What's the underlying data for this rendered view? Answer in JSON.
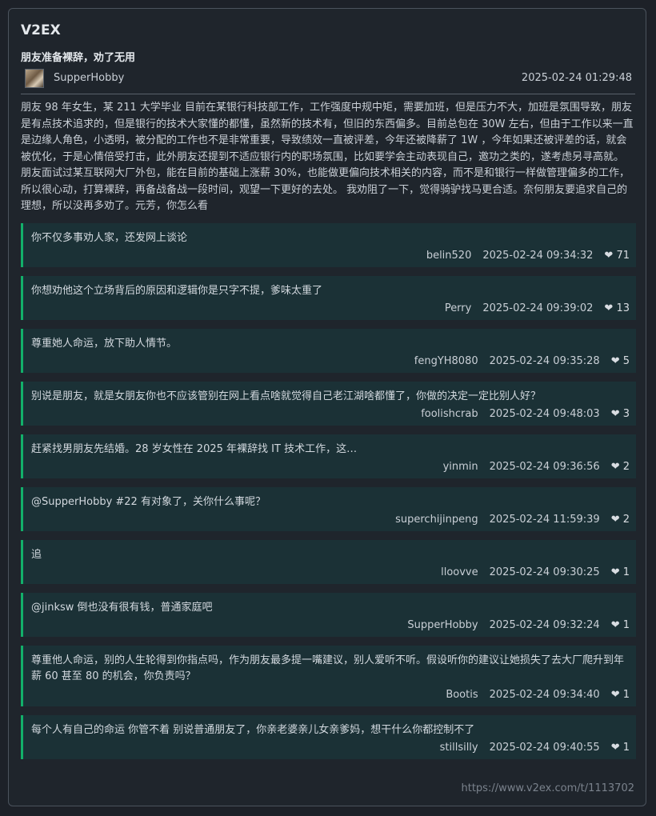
{
  "site": {
    "title": "V2EX"
  },
  "topic": {
    "title": "朋友准备裸辞，劝了无用",
    "author": "SupperHobby",
    "date": "2025-02-24 01:29:48",
    "content": "朋友 98 年女生，某 211 大学毕业 目前在某银行科技部工作，工作强度中规中矩，需要加班，但是压力不大，加班是氛围导致，朋友是有点技术追求的，但是银行的技术大家懂的都懂，虽然新的技术有，但旧的东西偏多。目前总包在 30W 左右，但由于工作以来一直是边缘人角色，小透明，被分配的工作也不是非常重要，导致绩效一直被评差，今年还被降薪了 1W ，今年如果还被评差的话，就会被优化，于是心情倍受打击，此外朋友还提到不适应银行内的职场氛围，比如要学会主动表现自己，邀功之类的，遂考虑另寻高就。 朋友面试过某互联网大厂外包，能在目前的基础上涨薪 30%，也能做更偏向技术相关的内容，而不是和银行一样做管理偏多的工作，所以很心动，打算裸辞，再备战备战一段时间，观望一下更好的去处。 我劝阻了一下，觉得骑驴找马更合适。奈何朋友要追求自己的理想，所以没再多劝了。元芳，你怎么看"
  },
  "replies": [
    {
      "text": "你不仅多事劝人家，还发网上谈论",
      "user": "belin520",
      "time": "2025-02-24 09:34:32",
      "likes": "❤ 71"
    },
    {
      "text": "你想劝他这个立场背后的原因和逻辑你是只字不提，爹味太重了",
      "user": "Perry",
      "time": "2025-02-24 09:39:02",
      "likes": "❤ 13"
    },
    {
      "text": "尊重她人命运，放下助人情节。",
      "user": "fengYH8080",
      "time": "2025-02-24 09:35:28",
      "likes": "❤ 5"
    },
    {
      "text": "别说是朋友，就是女朋友你也不应该管别在网上看点啥就觉得自己老江湖啥都懂了，你做的决定一定比别人好？",
      "user": "foolishcrab",
      "time": "2025-02-24 09:48:03",
      "likes": "❤ 3"
    },
    {
      "text": "赶紧找男朋友先结婚。28 岁女性在 2025 年裸辞找 IT 技术工作，这…",
      "user": "yinmin",
      "time": "2025-02-24 09:36:56",
      "likes": "❤ 2"
    },
    {
      "text": "@SupperHobby #22 有对象了，关你什么事呢？",
      "user": "superchijinpeng",
      "time": "2025-02-24 11:59:39",
      "likes": "❤ 2"
    },
    {
      "text": "追",
      "user": "lloovve",
      "time": "2025-02-24 09:30:25",
      "likes": "❤ 1"
    },
    {
      "text": "@jinksw 倒也没有很有钱，普通家庭吧",
      "user": "SupperHobby",
      "time": "2025-02-24 09:32:24",
      "likes": "❤ 1"
    },
    {
      "text": "尊重他人命运，别的人生轮得到你指点吗，作为朋友最多提一嘴建议，别人爱听不听。假设听你的建议让她损失了去大厂爬升到年薪 60 甚至 80 的机会，你负责吗？",
      "user": "Bootis",
      "time": "2025-02-24 09:34:40",
      "likes": "❤ 1"
    },
    {
      "text": "每个人有自己的命运 你管不着 别说普通朋友了，你亲老婆亲儿女亲爹妈，想干什么你都控制不了",
      "user": "stillsilly",
      "time": "2025-02-24 09:40:55",
      "likes": "❤ 1"
    }
  ],
  "footer": {
    "url": "https://www.v2ex.com/t/1113702"
  },
  "colors": {
    "reply_accent": "#12b06a",
    "reply_bg": "#1b3136",
    "page_bg": "#1f252c"
  }
}
